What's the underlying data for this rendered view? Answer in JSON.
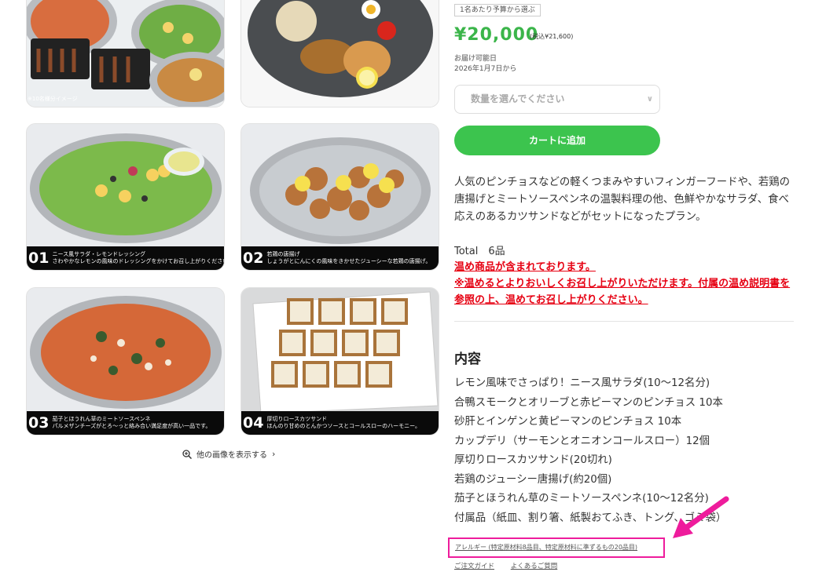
{
  "colors": {
    "accent": "#3cc44e",
    "price": "#3bb54a",
    "warning": "#e60012",
    "highlight": "#ee1c9c"
  },
  "gallery": {
    "top_left_note": "※10名様分イメージ",
    "tiles": [
      {
        "num": "01",
        "line1": "ニース風サラダ・レモンドレッシング",
        "line2": "さわやかなレモンの風味のドレッシングをかけてお召し上がりください。"
      },
      {
        "num": "02",
        "line1": "若鶏の唐揚げ",
        "line2": "しょうがとにんにくの風味をきかせたジューシーな若鶏の唐揚げ。"
      },
      {
        "num": "03",
        "line1": "茄子とほうれん草のミートソースペンネ",
        "line2": "パルメザンチーズがとろ～っと絡み合い満足度が高い一品です。"
      },
      {
        "num": "04",
        "line1": "厚切りロースカツサンド",
        "line2": "ほんのり甘めのとんかつソースとコールスローのハーモニー。"
      }
    ],
    "more_label": "他の画像を表示する",
    "more_icon": "zoom-in-icon"
  },
  "product": {
    "budget_tag": "1名あたり予算から選ぶ",
    "price": "¥20,000",
    "tax_note": "(税込¥21,600)",
    "delivery_label": "お届け可能日",
    "delivery_value": "2026年1月7日から",
    "qty_placeholder": "数量を選んでください",
    "cart_label": "カートに追加",
    "description": "人気のピンチョスなどの軽くつまみやすいフィンガーフードや、若鶏の唐揚げとミートソースペンネの温製料理の他、色鮮やかなサラダ、食べ応えのあるカツサンドなどがセットになったプラン。",
    "total": "Total　6品",
    "warning_1": "温め商品が含まれております。",
    "warning_2": "※温めるとよりおいしくお召し上がりいただけます。付属の温め説明書を参照の上、温めてお召し上がりください。"
  },
  "contents": {
    "heading": "内容",
    "items": [
      "レモン風味でさっぱり！ニース風サラダ(10〜12名分)",
      "合鴨スモークとオリーブと赤ピーマンのピンチョス 10本",
      "砂肝とインゲンと黄ピーマンのピンチョス 10本",
      "カップデリ（サーモンとオニオンコールスロー）12個",
      "厚切りロースカツサンド(20切れ)",
      "若鶏のジューシー唐揚げ(約20個)",
      "茄子とほうれん草のミートソースペンネ(10〜12名分)",
      "付属品（紙皿、割り箸、紙製おてふき、トング、ゴミ袋）"
    ]
  },
  "links": {
    "allergy": "アレルギー (特定原材料8品目、特定原材料に準ずるもの20品目)",
    "order_guide": "ご注文ガイド",
    "faq": "よくあるご質問"
  }
}
